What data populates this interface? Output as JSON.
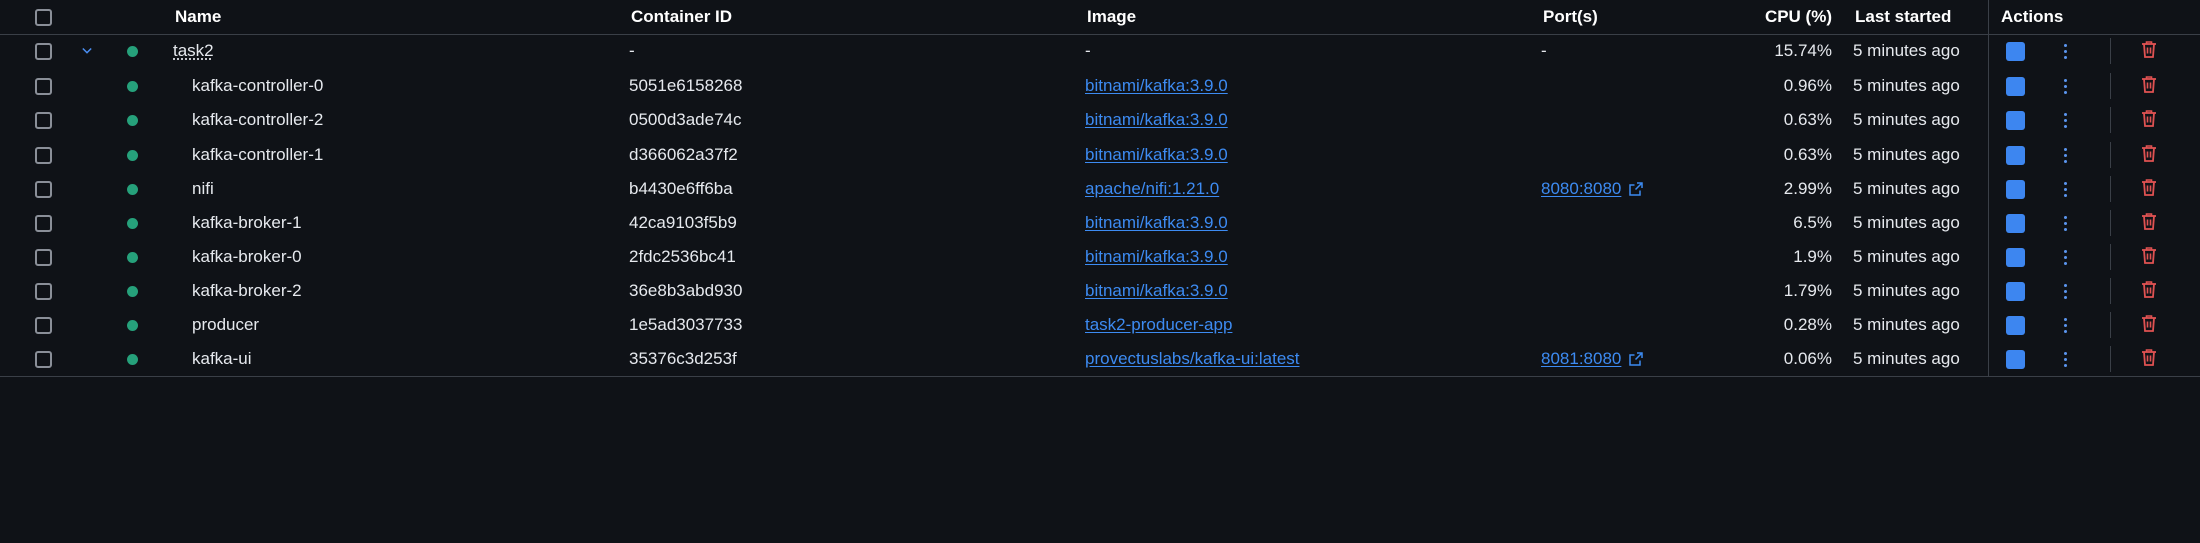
{
  "header": {
    "name": "Name",
    "container_id": "Container ID",
    "image": "Image",
    "ports": "Port(s)",
    "cpu": "CPU (%)",
    "last_started": "Last started",
    "actions": "Actions"
  },
  "group": {
    "name": "task2",
    "container_id": "-",
    "image": "-",
    "ports": "-",
    "cpu": "15.74%",
    "last_started": "5 minutes ago"
  },
  "rows": [
    {
      "name": "kafka-controller-0",
      "container_id": "5051e6158268",
      "image": "bitnami/kafka:3.9.0",
      "ports": "",
      "cpu": "0.96%",
      "last_started": "5 minutes ago"
    },
    {
      "name": "kafka-controller-2",
      "container_id": "0500d3ade74c",
      "image": "bitnami/kafka:3.9.0",
      "ports": "",
      "cpu": "0.63%",
      "last_started": "5 minutes ago"
    },
    {
      "name": "kafka-controller-1",
      "container_id": "d366062a37f2",
      "image": "bitnami/kafka:3.9.0",
      "ports": "",
      "cpu": "0.63%",
      "last_started": "5 minutes ago"
    },
    {
      "name": "nifi",
      "container_id": "b4430e6ff6ba",
      "image": "apache/nifi:1.21.0",
      "ports": "8080:8080",
      "cpu": "2.99%",
      "last_started": "5 minutes ago"
    },
    {
      "name": "kafka-broker-1",
      "container_id": "42ca9103f5b9",
      "image": "bitnami/kafka:3.9.0",
      "ports": "",
      "cpu": "6.5%",
      "last_started": "5 minutes ago"
    },
    {
      "name": "kafka-broker-0",
      "container_id": "2fdc2536bc41",
      "image": "bitnami/kafka:3.9.0",
      "ports": "",
      "cpu": "1.9%",
      "last_started": "5 minutes ago"
    },
    {
      "name": "kafka-broker-2",
      "container_id": "36e8b3abd930",
      "image": "bitnami/kafka:3.9.0",
      "ports": "",
      "cpu": "1.79%",
      "last_started": "5 minutes ago"
    },
    {
      "name": "producer",
      "container_id": "1e5ad3037733",
      "image": "task2-producer-app",
      "ports": "",
      "cpu": "0.28%",
      "last_started": "5 minutes ago"
    },
    {
      "name": "kafka-ui",
      "container_id": "35376c3d253f",
      "image": "provectuslabs/kafka-ui:latest",
      "ports": "8081:8080",
      "cpu": "0.06%",
      "last_started": "5 minutes ago"
    }
  ],
  "icons": {
    "status": "status-running-dot",
    "expand": "chevron-down-icon",
    "stop": "stop-icon",
    "more": "kebab-menu-icon",
    "delete": "trash-icon",
    "external": "external-link-icon"
  },
  "colors": {
    "background": "#0f1217",
    "status_running": "#26a17b",
    "link": "#3d8bf2",
    "stop": "#3d86f0",
    "delete": "#e05252"
  }
}
